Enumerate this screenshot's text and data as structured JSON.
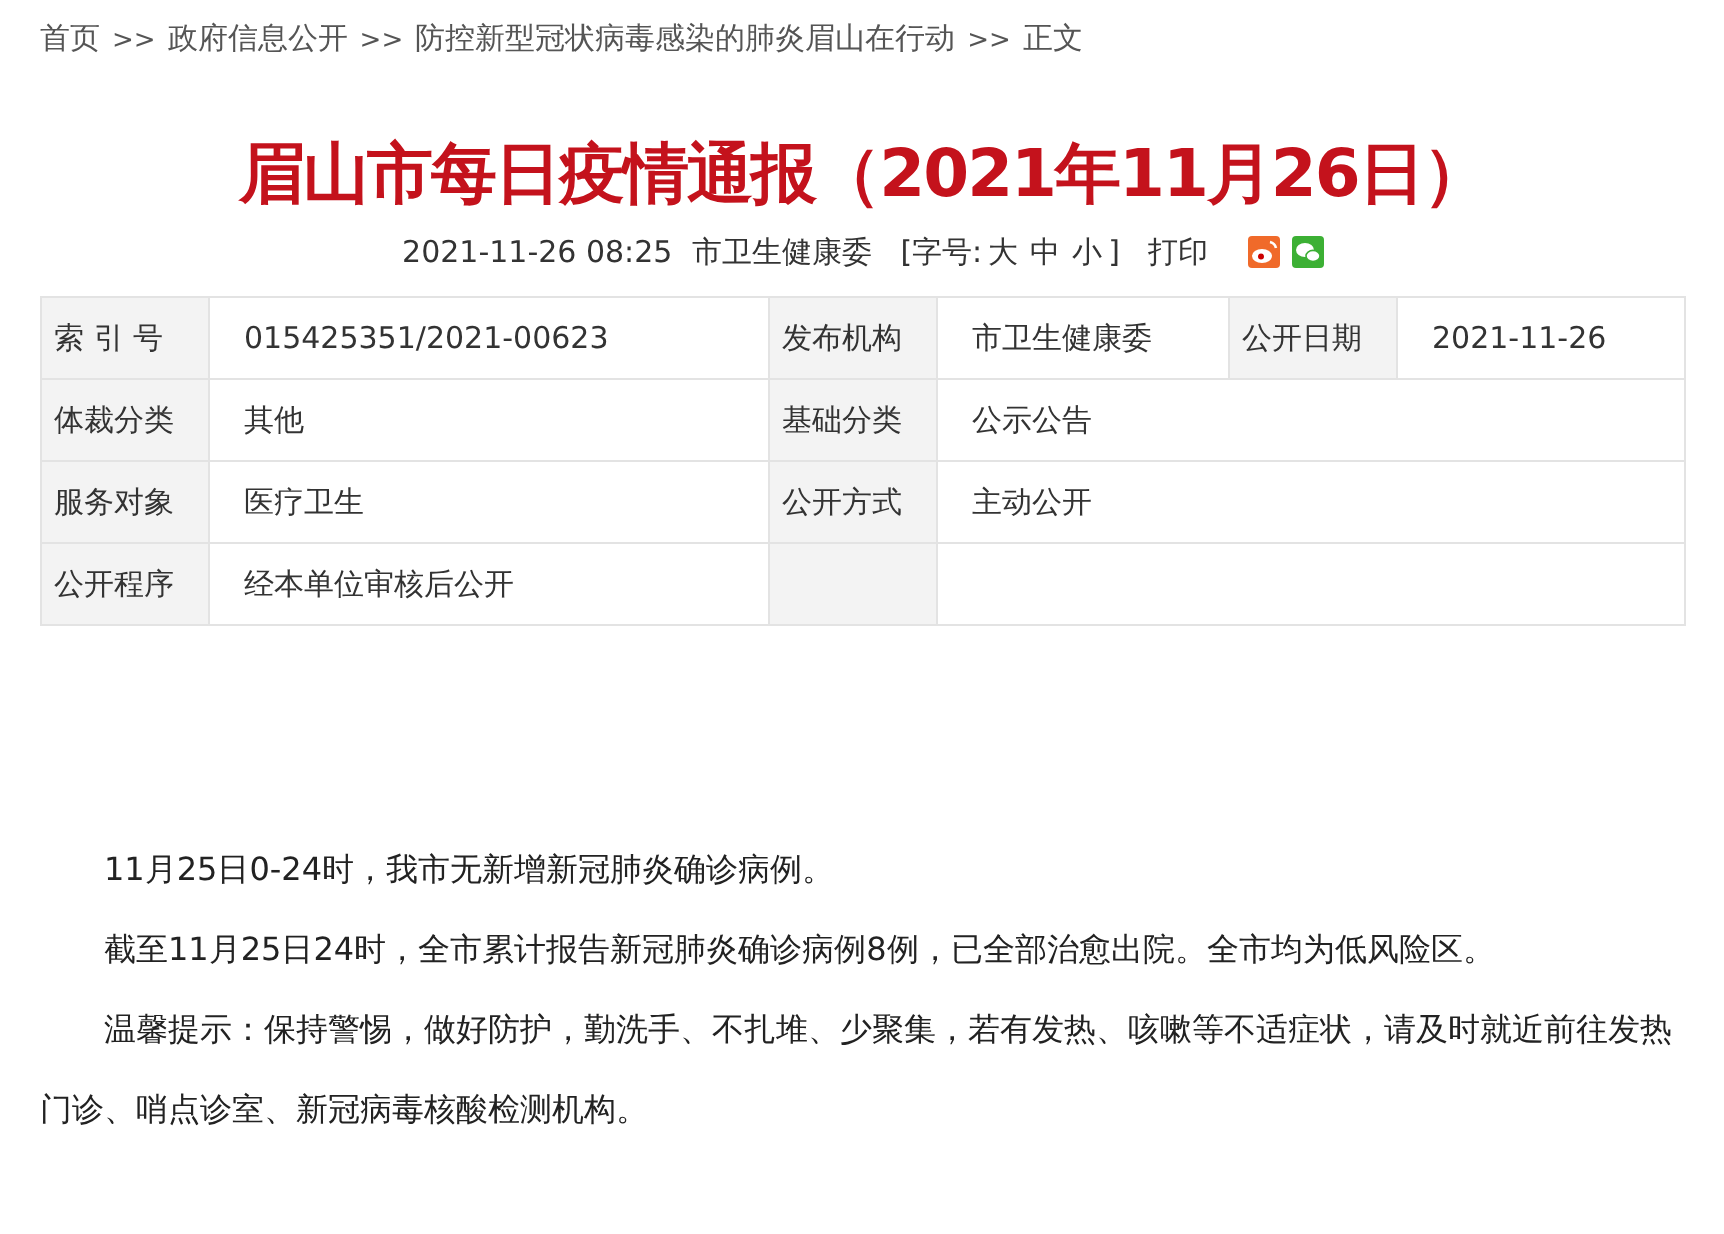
{
  "breadcrumb": [
    "首页",
    "政府信息公开",
    "防控新型冠状病毒感染的肺炎眉山在行动",
    "正文"
  ],
  "breadcrumb_separator": ">>",
  "title": "眉山市每日疫情通报（2021年11月26日）",
  "meta": {
    "datetime": "2021-11-26 08:25",
    "source": "市卫生健康委",
    "font_size_label": "[字号:",
    "font_sizes": [
      "大",
      "中",
      "小"
    ],
    "font_size_end": "]",
    "print": "打印"
  },
  "info_table": [
    [
      {
        "label": "索 引 号",
        "value": "015425351/2021-00623"
      },
      {
        "label": "发布机构",
        "value": "市卫生健康委"
      },
      {
        "label": "公开日期",
        "value": "2021-11-26"
      }
    ],
    [
      {
        "label": "体裁分类",
        "value": "其他"
      },
      {
        "label": "基础分类",
        "value": "公示公告"
      }
    ],
    [
      {
        "label": "服务对象",
        "value": "医疗卫生"
      },
      {
        "label": "公开方式",
        "value": "主动公开"
      }
    ],
    [
      {
        "label": "公开程序",
        "value": "经本单位审核后公开"
      }
    ]
  ],
  "paragraphs": [
    "11月25日0-24时，我市无新增新冠肺炎确诊病例。",
    "截至11月25日24时，全市累计报告新冠肺炎确诊病例8例，已全部治愈出院。全市均为低风险区。",
    "温馨提示：保持警惕，做好防护，勤洗手、不扎堆、少聚集，若有发热、咳嗽等不适症状，请及时就近前往发热门诊、哨点诊室、新冠病毒核酸检测机构。"
  ]
}
